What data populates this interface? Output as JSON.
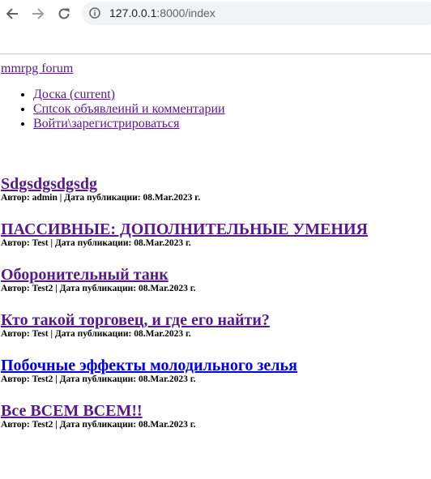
{
  "browser": {
    "url_host": "127.0.0.1",
    "url_rest": ":8000/index"
  },
  "site": {
    "brand": "mmrpg forum"
  },
  "nav": [
    {
      "label": "Доска (current)"
    },
    {
      "label": "Спtсок объявлеинй и комментарии"
    },
    {
      "label": "Войти\\зарегистрироваться"
    }
  ],
  "posts": [
    {
      "title": "Sdgsdgsdgsdg",
      "meta": "Автор: admin | Дата публикации: 08.Mar.2023 г.",
      "visited": true
    },
    {
      "title": "ПАССИВНЫЕ: ДОПОЛНИТЕЛЬНЫЕ УМЕНИЯ",
      "meta": "Автор: Test | Дата публикации: 08.Mar.2023 г.",
      "visited": true
    },
    {
      "title": "Оборонительный танк",
      "meta": "Автор: Test2 | Дата публикации: 08.Mar.2023 г.",
      "visited": true
    },
    {
      "title": "Кто такой торговец, и где его найти?",
      "meta": "Автор: Test | Дата публикации: 08.Mar.2023 г.",
      "visited": true
    },
    {
      "title": "Побочные эффекты молодильного зелья",
      "meta": "Автор: Test2 | Дата публикации: 08.Mar.2023 г.",
      "visited": false
    },
    {
      "title": "Все ВСЕМ ВСЕМ!!",
      "meta": "Автор: Test2 | Дата публикации: 08.Mar.2023 г.",
      "visited": true
    }
  ]
}
